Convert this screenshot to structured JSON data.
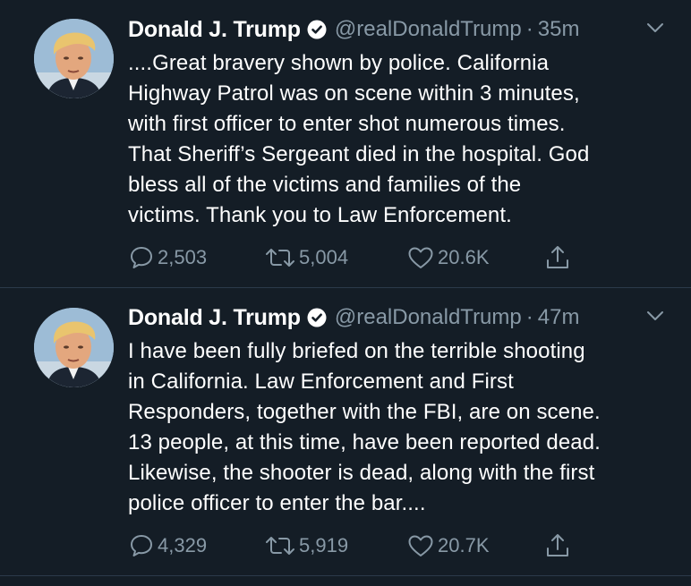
{
  "tweets": [
    {
      "name": "Donald J. Trump",
      "handle": "@realDonaldTrump",
      "separator": "·",
      "time": "35m",
      "lines": [
        "....Great bravery shown by police. California",
        "Highway Patrol was on scene within 3 minutes,",
        "with first officer to enter shot numerous times.",
        "That Sheriff’s Sergeant died in the hospital. God",
        "bless all of the victims and families of the",
        "victims. Thank you to Law Enforcement."
      ],
      "replies": "2,503",
      "retweets": "5,004",
      "likes": "20.6K"
    },
    {
      "name": "Donald J. Trump",
      "handle": "@realDonaldTrump",
      "separator": "·",
      "time": "47m",
      "lines": [
        "I have been fully briefed on the terrible shooting",
        "in California. Law Enforcement and First",
        "Responders, together with the FBI, are on scene.",
        "13 people, at this time, have been reported dead.",
        "Likewise, the shooter is dead, along with the first",
        "police officer to enter the bar...."
      ],
      "replies": "4,329",
      "retweets": "5,919",
      "likes": "20.7K"
    }
  ],
  "icons": {
    "verified": "verified-badge-icon",
    "chevron": "chevron-down-icon",
    "reply": "reply-icon",
    "retweet": "retweet-icon",
    "like": "heart-icon",
    "share": "share-icon"
  },
  "colors": {
    "background": "#141d26",
    "text": "#ffffff",
    "secondary": "#8899a6",
    "divider": "#2b3a4a"
  }
}
